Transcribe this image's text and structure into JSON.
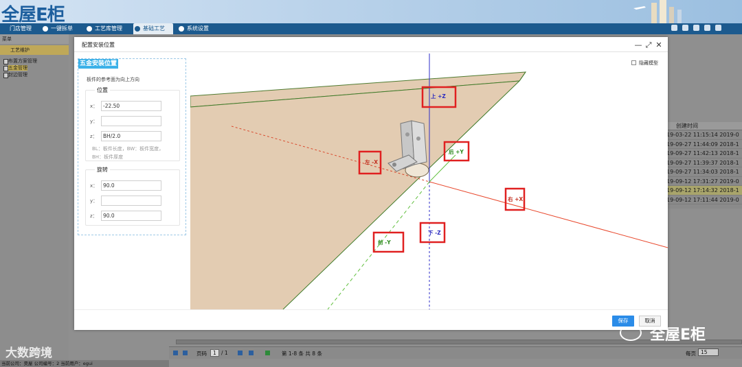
{
  "app": {
    "logo": "全屋E柜"
  },
  "nav": {
    "items": [
      {
        "label": "门店管理",
        "active": false
      },
      {
        "label": "一键拆单",
        "active": false
      },
      {
        "label": "工艺库管理",
        "active": false
      },
      {
        "label": "基础工艺",
        "active": true
      },
      {
        "label": "系统设置",
        "active": false
      }
    ],
    "toolbar_icons": [
      "monitor-icon",
      "save-icon",
      "user-icon",
      "settings-icon",
      "exit-icon"
    ]
  },
  "sidebar": {
    "header": "菜单",
    "section": "工艺维护",
    "items": [
      {
        "label": "布置方案管理",
        "selected": false
      },
      {
        "label": "五金管理",
        "selected": true
      },
      {
        "label": "封边管理",
        "selected": false
      }
    ]
  },
  "background_grid": {
    "header": "创建时间",
    "rows": [
      {
        "created": "19-03-22 11:15:14",
        "next": "2019-0",
        "selected": false
      },
      {
        "created": "19-09-27 11:44:09",
        "next": "2018-1",
        "selected": false
      },
      {
        "created": "19-09-27 11:42:13",
        "next": "2018-1",
        "selected": false
      },
      {
        "created": "19-09-27 11:39:37",
        "next": "2018-1",
        "selected": false
      },
      {
        "created": "19-09-27 11:34:03",
        "next": "2018-1",
        "selected": false
      },
      {
        "created": "19-09-12 17:31:27",
        "next": "2019-0",
        "selected": false
      },
      {
        "created": "19-09-12 17:14:32",
        "next": "2018-1",
        "selected": true
      },
      {
        "created": "19-09-12 17:11:44",
        "next": "2019-0",
        "selected": false
      }
    ]
  },
  "pager": {
    "page_label": "页码",
    "page": "1",
    "of": "/ 1",
    "summary": "第 1-8 条  共 8 条",
    "per_page_label": "每页",
    "per_page": "15"
  },
  "status": {
    "text": "当前公司：昊屋 公司编号：2 当前用户：egui"
  },
  "watermarks": {
    "left": "大数跨境",
    "right": "全屋E柜"
  },
  "dialog": {
    "title": "配置安装位置",
    "panel_title": "五金安装位置",
    "hint": "板件的参考面为向上方向",
    "position": {
      "legend": "位置",
      "x_label": "x：",
      "x_value": "-22.50",
      "y_label": "y：",
      "y_value": "",
      "z_label": "z：",
      "z_value": "BH/2.0",
      "note": "BL：板件长度，BW：板件宽度，BH：板件厚度"
    },
    "rotation": {
      "legend": "旋转",
      "x_label": "x：",
      "x_value": "90.0",
      "y_label": "y：",
      "y_value": "",
      "z_label": "z：",
      "z_value": "90.0"
    },
    "hide_model": "隐藏模型",
    "save": "保存",
    "cancel": "取消",
    "axis_labels": {
      "top": "上 +Z",
      "bottom": "下 -Z",
      "left": "左 -X",
      "right": "右 +X",
      "front": "前 -Y",
      "back": "后 +Y"
    }
  }
}
